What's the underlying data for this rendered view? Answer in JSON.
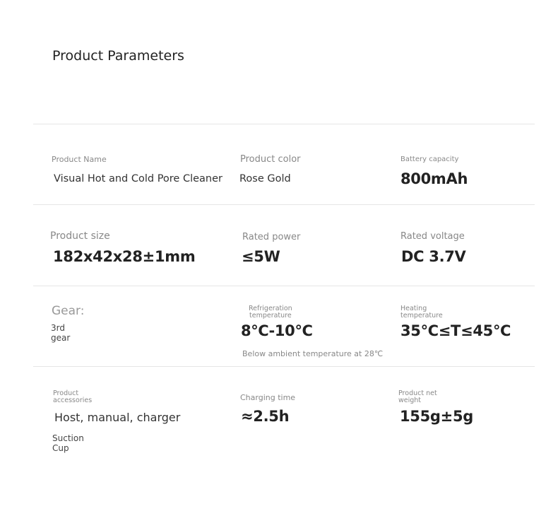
{
  "title": "Product Parameters",
  "rows": [
    {
      "product_name": {
        "label": "Product Name",
        "value": "Visual Hot and Cold Pore Cleaner"
      },
      "product_color": {
        "label": "Product color",
        "value": "Rose Gold"
      },
      "battery_capacity": {
        "label": "Battery capacity",
        "value": "800mAh"
      }
    },
    {
      "product_size": {
        "label": "Product size",
        "value": "182x42x28±1mm"
      },
      "rated_power": {
        "label": "Rated power",
        "value": "≤5W"
      },
      "rated_voltage": {
        "label": "Rated voltage",
        "value": "DC 3.7V"
      }
    },
    {
      "gear": {
        "label": "Gear:",
        "value_line1": "3rd",
        "value_line2": "gear"
      },
      "refrigeration": {
        "label_line1": "Refrigeration",
        "label_line2": "temperature",
        "value": "8℃-10℃",
        "note": "Below ambient temperature at 28℃"
      },
      "heating": {
        "label_line1": "Heating",
        "label_line2": "temperature",
        "value": "35℃≤T≤45℃"
      }
    },
    {
      "accessories": {
        "label_line1": "Product",
        "label_line2": "accessories",
        "value": "Host, manual, charger",
        "extra_line1": "Suction",
        "extra_line2": "Cup"
      },
      "charging_time": {
        "label": "Charging time",
        "value": "≈2.5h"
      },
      "net_weight": {
        "label_line1": "Product net",
        "label_line2": "weight",
        "value": "155g±5g"
      }
    }
  ]
}
